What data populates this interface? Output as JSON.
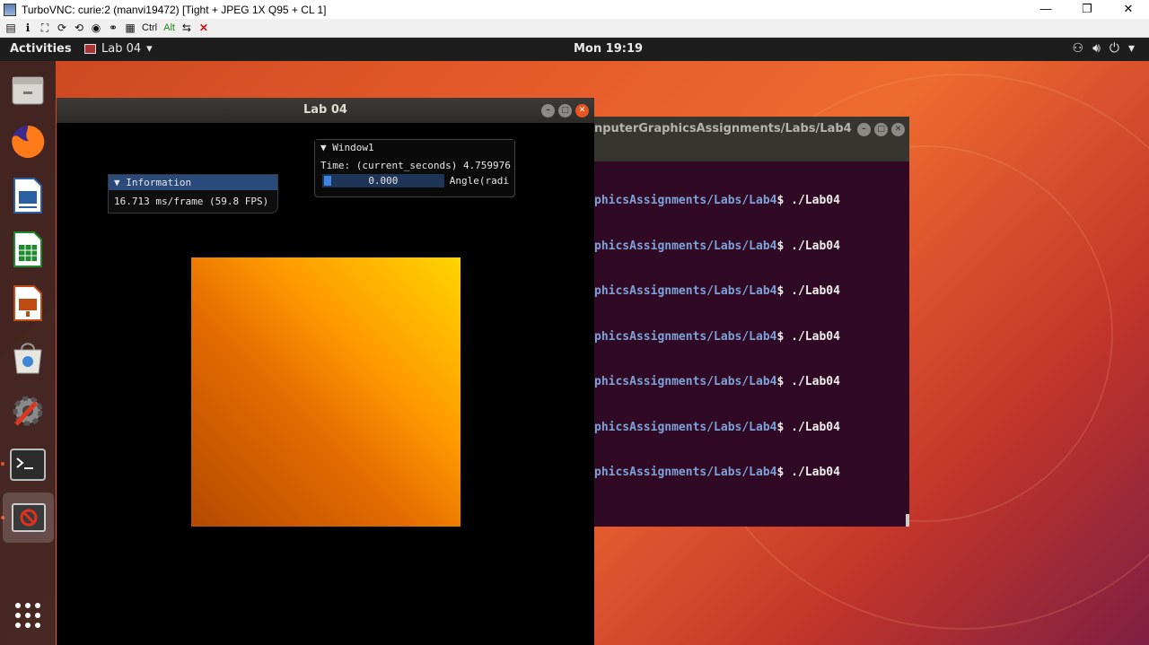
{
  "vnc": {
    "title": "TurboVNC: curie:2 (manvi19472) [Tight + JPEG 1X Q95 + CL 1]",
    "toolbar": {
      "ctrl_label": "Ctrl",
      "alt_label": "Alt"
    },
    "window_controls": {
      "minimize": "—",
      "restore": "❐",
      "close": "✕"
    }
  },
  "topbar": {
    "activities": "Activities",
    "app_menu_label": "Lab 04",
    "clock": "Mon 19:19"
  },
  "dock": {
    "items": [
      "file-manager",
      "firefox",
      "writer",
      "calc",
      "impress",
      "software-center",
      "settings",
      "terminal",
      "lab04-app"
    ],
    "show_apps": "show-apps"
  },
  "lab_window": {
    "title": "Lab 04",
    "info_panel": {
      "header": "Information",
      "fps_text": "16.713 ms/frame (59.8 FPS)"
    },
    "window1_panel": {
      "header": "Window1",
      "time_text": "Time: (current_seconds) 4.759976",
      "slider_value": "0.000",
      "slider_label": "Angle(radi"
    }
  },
  "terminal": {
    "title": "nputerGraphicsAssignments/Labs/Lab4",
    "lines": [
      {
        "path": "phicsAssignments/Labs/Lab4",
        "cmd": "$ ./Lab04"
      },
      {
        "path": "phicsAssignments/Labs/Lab4",
        "cmd": "$ ./Lab04"
      },
      {
        "path": "phicsAssignments/Labs/Lab4",
        "cmd": "$ ./Lab04"
      },
      {
        "path": "phicsAssignments/Labs/Lab4",
        "cmd": "$ ./Lab04"
      },
      {
        "path": "phicsAssignments/Labs/Lab4",
        "cmd": "$ ./Lab04"
      },
      {
        "path": "phicsAssignments/Labs/Lab4",
        "cmd": "$ ./Lab04"
      },
      {
        "path": "phicsAssignments/Labs/Lab4",
        "cmd": "$ ./Lab04"
      }
    ]
  },
  "colors": {
    "ubuntu_orange": "#e95420",
    "terminal_bg": "#300a24",
    "imgui_header": "#294a7a"
  }
}
